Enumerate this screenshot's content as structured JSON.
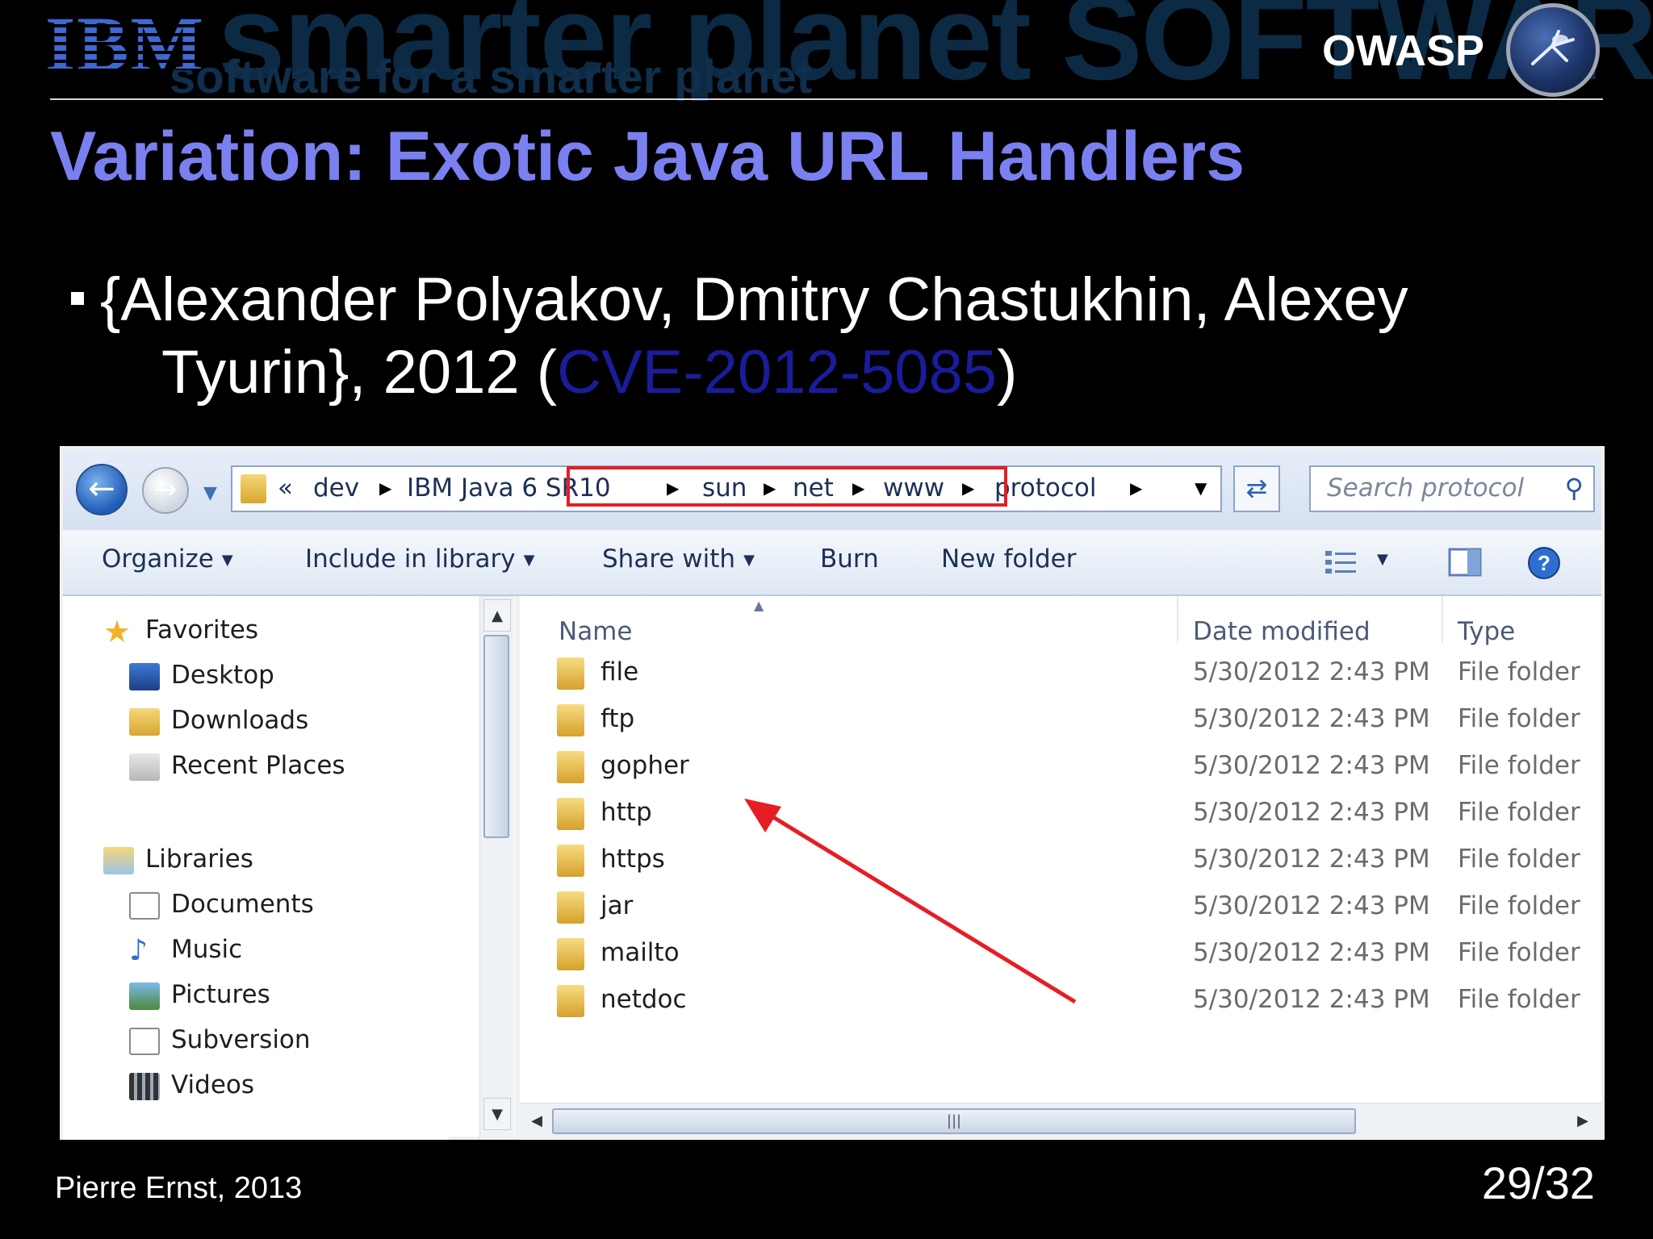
{
  "header": {
    "ibm_logo": "IBM",
    "banner_text_large": "smarter planet  SOFTWARE",
    "banner_text_small": "software for a smarter planet",
    "owasp_label": "OWASP"
  },
  "slide": {
    "title": "Variation: Exotic Java URL Handlers",
    "bullet_line1": "{Alexander Polyakov, Dmitry Chastukhin, Alexey",
    "bullet_line2_prefix": "Tyurin}, 2012 (",
    "bullet_cve": "CVE-2012-5085",
    "bullet_line2_suffix": ")"
  },
  "explorer": {
    "breadcrumb": {
      "overflow": "«",
      "segments": [
        "dev",
        "IBM Java 6 SR10",
        "sun",
        "net",
        "www",
        "protocol"
      ]
    },
    "search_placeholder": "Search protocol",
    "toolbar": {
      "organize": "Organize",
      "include_in_library": "Include in library",
      "share_with": "Share with",
      "burn": "Burn",
      "new_folder": "New folder"
    },
    "nav": {
      "favorites": "Favorites",
      "desktop": "Desktop",
      "downloads": "Downloads",
      "recent_places": "Recent Places",
      "libraries": "Libraries",
      "documents": "Documents",
      "music": "Music",
      "pictures": "Pictures",
      "subversion": "Subversion",
      "videos": "Videos"
    },
    "columns": {
      "name": "Name",
      "date_modified": "Date modified",
      "type": "Type"
    },
    "files": [
      {
        "name": "file",
        "date": "5/30/2012 2:43 PM",
        "type": "File folder"
      },
      {
        "name": "ftp",
        "date": "5/30/2012 2:43 PM",
        "type": "File folder"
      },
      {
        "name": "gopher",
        "date": "5/30/2012 2:43 PM",
        "type": "File folder"
      },
      {
        "name": "http",
        "date": "5/30/2012 2:43 PM",
        "type": "File folder"
      },
      {
        "name": "https",
        "date": "5/30/2012 2:43 PM",
        "type": "File folder"
      },
      {
        "name": "jar",
        "date": "5/30/2012 2:43 PM",
        "type": "File folder"
      },
      {
        "name": "mailto",
        "date": "5/30/2012 2:43 PM",
        "type": "File folder"
      },
      {
        "name": "netdoc",
        "date": "5/30/2012 2:43 PM",
        "type": "File folder"
      }
    ]
  },
  "footer": {
    "author": "Pierre Ernst, 2013",
    "page": "29/32"
  },
  "colors": {
    "title": "#7a80ef",
    "cve_link": "#1a1c9a",
    "highlight_red": "#e61d24"
  }
}
